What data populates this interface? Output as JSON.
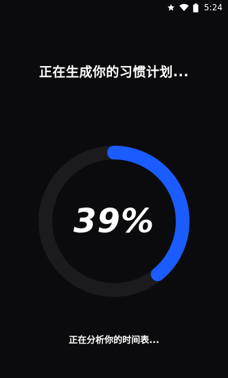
{
  "status_bar": {
    "time": "5:24",
    "icons": [
      "star-icon",
      "wifi-icon",
      "battery-icon"
    ]
  },
  "title": "正在生成你的习惯计划...",
  "progress": {
    "percent_label": "39%",
    "value": 0.39,
    "track_color": "#1b1b1e",
    "fill_color": "#1a5cff"
  },
  "sub_status": "正在分析你的时间表..."
}
